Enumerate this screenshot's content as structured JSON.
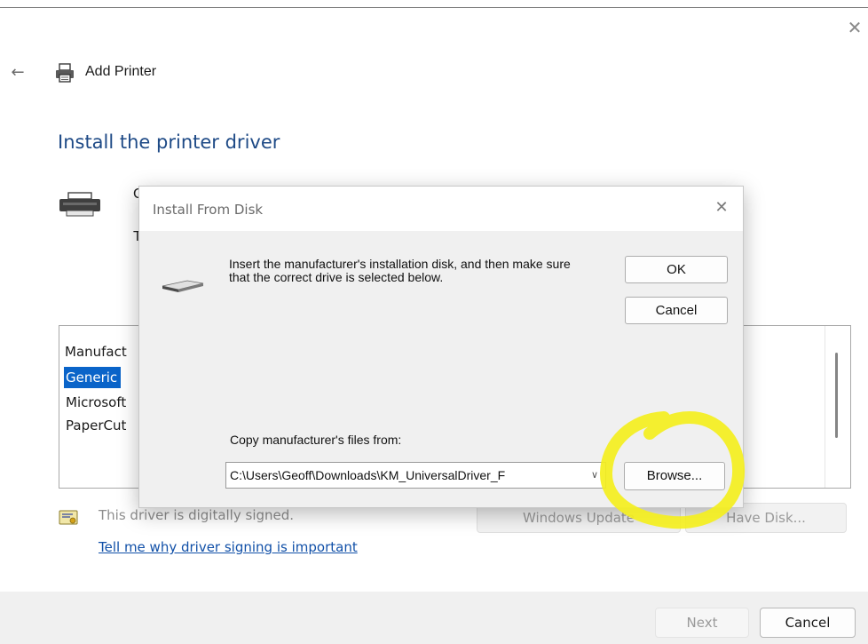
{
  "window": {
    "title": "Add Printer",
    "close_glyph": "✕",
    "back_glyph": "←",
    "icon": "printer-icon"
  },
  "page": {
    "heading": "Install the printer driver",
    "hidden_text_c": "C",
    "hidden_text_t": "T"
  },
  "list": {
    "header": "Manufact",
    "items": [
      {
        "label": "Generic",
        "selected": true
      },
      {
        "label": "Microsoft",
        "selected": false
      },
      {
        "label": "PaperCut",
        "selected": false
      }
    ]
  },
  "driver": {
    "signed_text": "This driver is digitally signed.",
    "signing_link": "Tell me why driver signing is important",
    "windows_update_label": "Windows Update",
    "have_disk_label": "Have Disk..."
  },
  "footer": {
    "next_label": "Next",
    "cancel_label": "Cancel"
  },
  "dialog": {
    "title": "Install From Disk",
    "close_glyph": "✕",
    "message": "Insert the manufacturer's installation disk, and then make sure that the correct drive is selected below.",
    "ok_label": "OK",
    "cancel_label": "Cancel",
    "copy_label": "Copy manufacturer's files from:",
    "path_value": "C:\\Users\\Geoff\\Downloads\\KM_UniversalDriver_F",
    "browse_label": "Browse...",
    "dropdown_glyph": "∨"
  },
  "colors": {
    "heading": "#1e4a86",
    "selection": "#0a64c9",
    "link": "#1150a8",
    "highlighter": "#f4ef1e"
  }
}
